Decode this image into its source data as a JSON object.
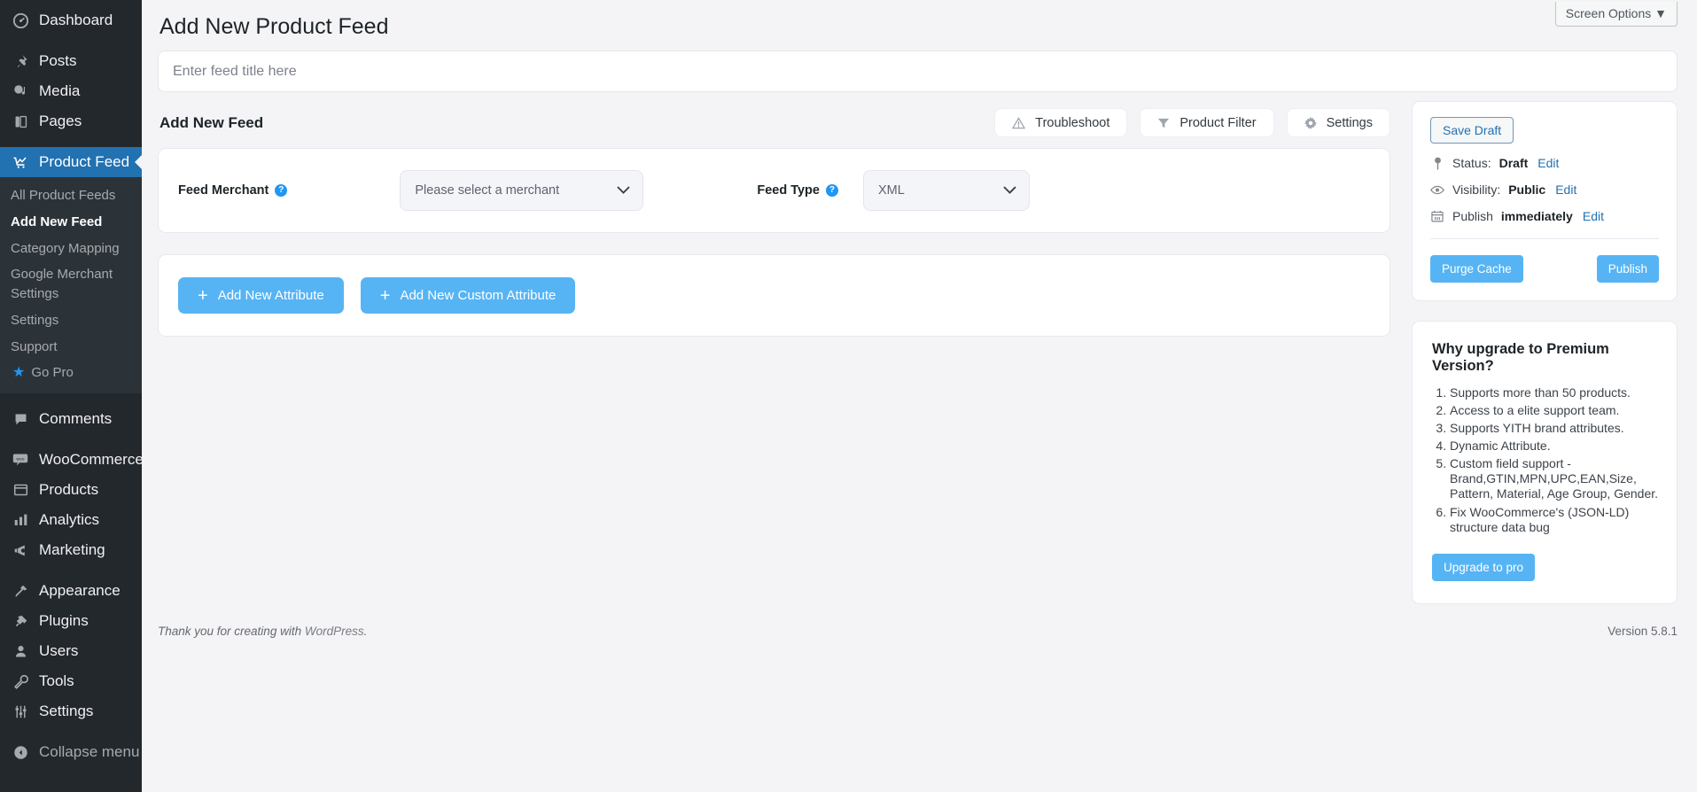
{
  "sidebar": {
    "items": [
      {
        "label": "Dashboard",
        "icon": "dashboard-icon"
      },
      {
        "label": "Posts",
        "icon": "pin-icon"
      },
      {
        "label": "Media",
        "icon": "media-icon"
      },
      {
        "label": "Pages",
        "icon": "pages-icon"
      },
      {
        "label": "Product Feed",
        "icon": "product-feed-icon",
        "active": true
      },
      {
        "label": "Comments",
        "icon": "comments-icon"
      },
      {
        "label": "WooCommerce",
        "icon": "woocommerce-icon"
      },
      {
        "label": "Products",
        "icon": "products-icon"
      },
      {
        "label": "Analytics",
        "icon": "analytics-icon"
      },
      {
        "label": "Marketing",
        "icon": "marketing-icon"
      },
      {
        "label": "Appearance",
        "icon": "appearance-icon"
      },
      {
        "label": "Plugins",
        "icon": "plugins-icon"
      },
      {
        "label": "Users",
        "icon": "users-icon"
      },
      {
        "label": "Tools",
        "icon": "tools-icon"
      },
      {
        "label": "Settings",
        "icon": "settings-icon"
      },
      {
        "label": "Collapse menu",
        "icon": "collapse-icon"
      }
    ],
    "submenu": [
      {
        "label": "All Product Feeds"
      },
      {
        "label": "Add New Feed",
        "current": true
      },
      {
        "label": "Category Mapping"
      },
      {
        "label": "Google Merchant Settings"
      },
      {
        "label": "Settings"
      },
      {
        "label": "Support"
      },
      {
        "label": "Go Pro",
        "icon": "star-icon"
      }
    ]
  },
  "header": {
    "screen_options": "Screen Options ▼",
    "page_title": "Add New Product Feed"
  },
  "title_field": {
    "placeholder": "Enter feed title here",
    "value": ""
  },
  "section": {
    "title": "Add New Feed",
    "buttons": [
      {
        "label": "Troubleshoot",
        "icon": "warning-triangle-icon"
      },
      {
        "label": "Product Filter",
        "icon": "filter-icon"
      },
      {
        "label": "Settings",
        "icon": "gear-icon"
      }
    ]
  },
  "feed_form": {
    "merchant_label": "Feed Merchant",
    "merchant_value": "Please select a merchant",
    "type_label": "Feed Type",
    "type_value": "XML",
    "help_glyph": "?"
  },
  "attributes": {
    "add_attribute": "Add New Attribute",
    "add_custom_attribute": "Add New Custom Attribute",
    "plus_glyph": "+"
  },
  "publish_box": {
    "save_draft": "Save Draft",
    "status_label": "Status:",
    "status_value": "Draft",
    "status_edit": "Edit",
    "visibility_label": "Visibility:",
    "visibility_value": "Public",
    "visibility_edit": "Edit",
    "publish_label": "Publish",
    "publish_value": "immediately",
    "publish_edit": "Edit",
    "purge_cache": "Purge Cache",
    "publish_button": "Publish"
  },
  "premium": {
    "title": "Why upgrade to Premium Version?",
    "items": [
      "Supports more than 50 products.",
      "Access to a elite support team.",
      "Supports YITH brand attributes.",
      "Dynamic Attribute.",
      "Custom field support - Brand,GTIN,MPN,UPC,EAN,Size, Pattern, Material, Age Group, Gender.",
      "Fix WooCommerce's (JSON-LD) structure data bug"
    ],
    "upgrade_button": "Upgrade to pro"
  },
  "footer": {
    "thanks_prefix": "Thank you for creating with ",
    "wordpress_link": "WordPress",
    "thanks_suffix": ".",
    "version": "Version 5.8.1"
  },
  "colors": {
    "sidebar_bg": "#23282d",
    "submenu_bg": "#2c3338",
    "active_blue": "#2271b1",
    "accent_blue": "#56b4f4",
    "link_blue": "#2271b1",
    "page_bg": "#f4f4f7"
  }
}
